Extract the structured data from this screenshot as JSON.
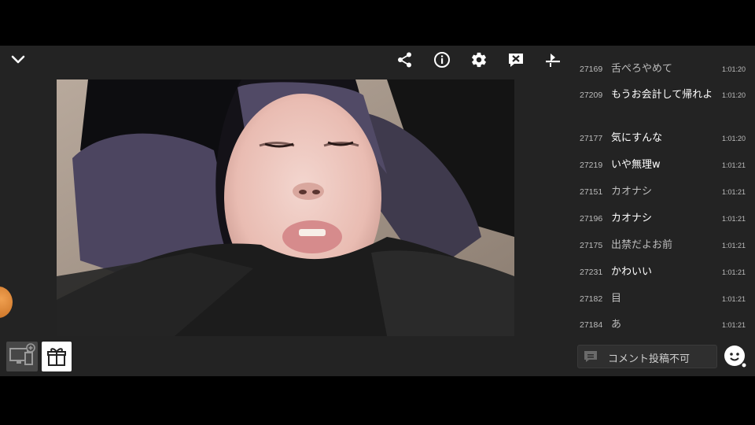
{
  "player": {
    "icons": {
      "collapse": "chevron-down-icon",
      "share": "share-icon",
      "info": "info-icon",
      "settings": "gear-icon",
      "close_comments": "comment-off-icon",
      "layout": "layout-toggle-icon",
      "screen": "screen-link-icon",
      "gift": "gift-icon"
    }
  },
  "chat": {
    "comments": [
      {
        "no": "27169",
        "text": "舌ぺろやめて",
        "time": "1:01:20",
        "dim": true
      },
      {
        "no": "27209",
        "text": "もうお会計して帰れよ",
        "time": "1:01:20",
        "dim": false
      },
      {
        "no": "27177",
        "text": "気にすんな",
        "time": "1:01:20",
        "dim": false
      },
      {
        "no": "27219",
        "text": "いや無理w",
        "time": "1:01:21",
        "dim": false
      },
      {
        "no": "27151",
        "text": "カオナシ",
        "time": "1:01:21",
        "dim": true
      },
      {
        "no": "27196",
        "text": "カオナシ",
        "time": "1:01:21",
        "dim": false
      },
      {
        "no": "27175",
        "text": "出禁だよお前",
        "time": "1:01:21",
        "dim": true
      },
      {
        "no": "27231",
        "text": "かわいい",
        "time": "1:01:21",
        "dim": false
      },
      {
        "no": "27182",
        "text": "目",
        "time": "1:01:21",
        "dim": true
      },
      {
        "no": "27184",
        "text": "あ",
        "time": "1:01:21",
        "dim": true
      }
    ],
    "input_placeholder": "コメント投稿不可"
  }
}
